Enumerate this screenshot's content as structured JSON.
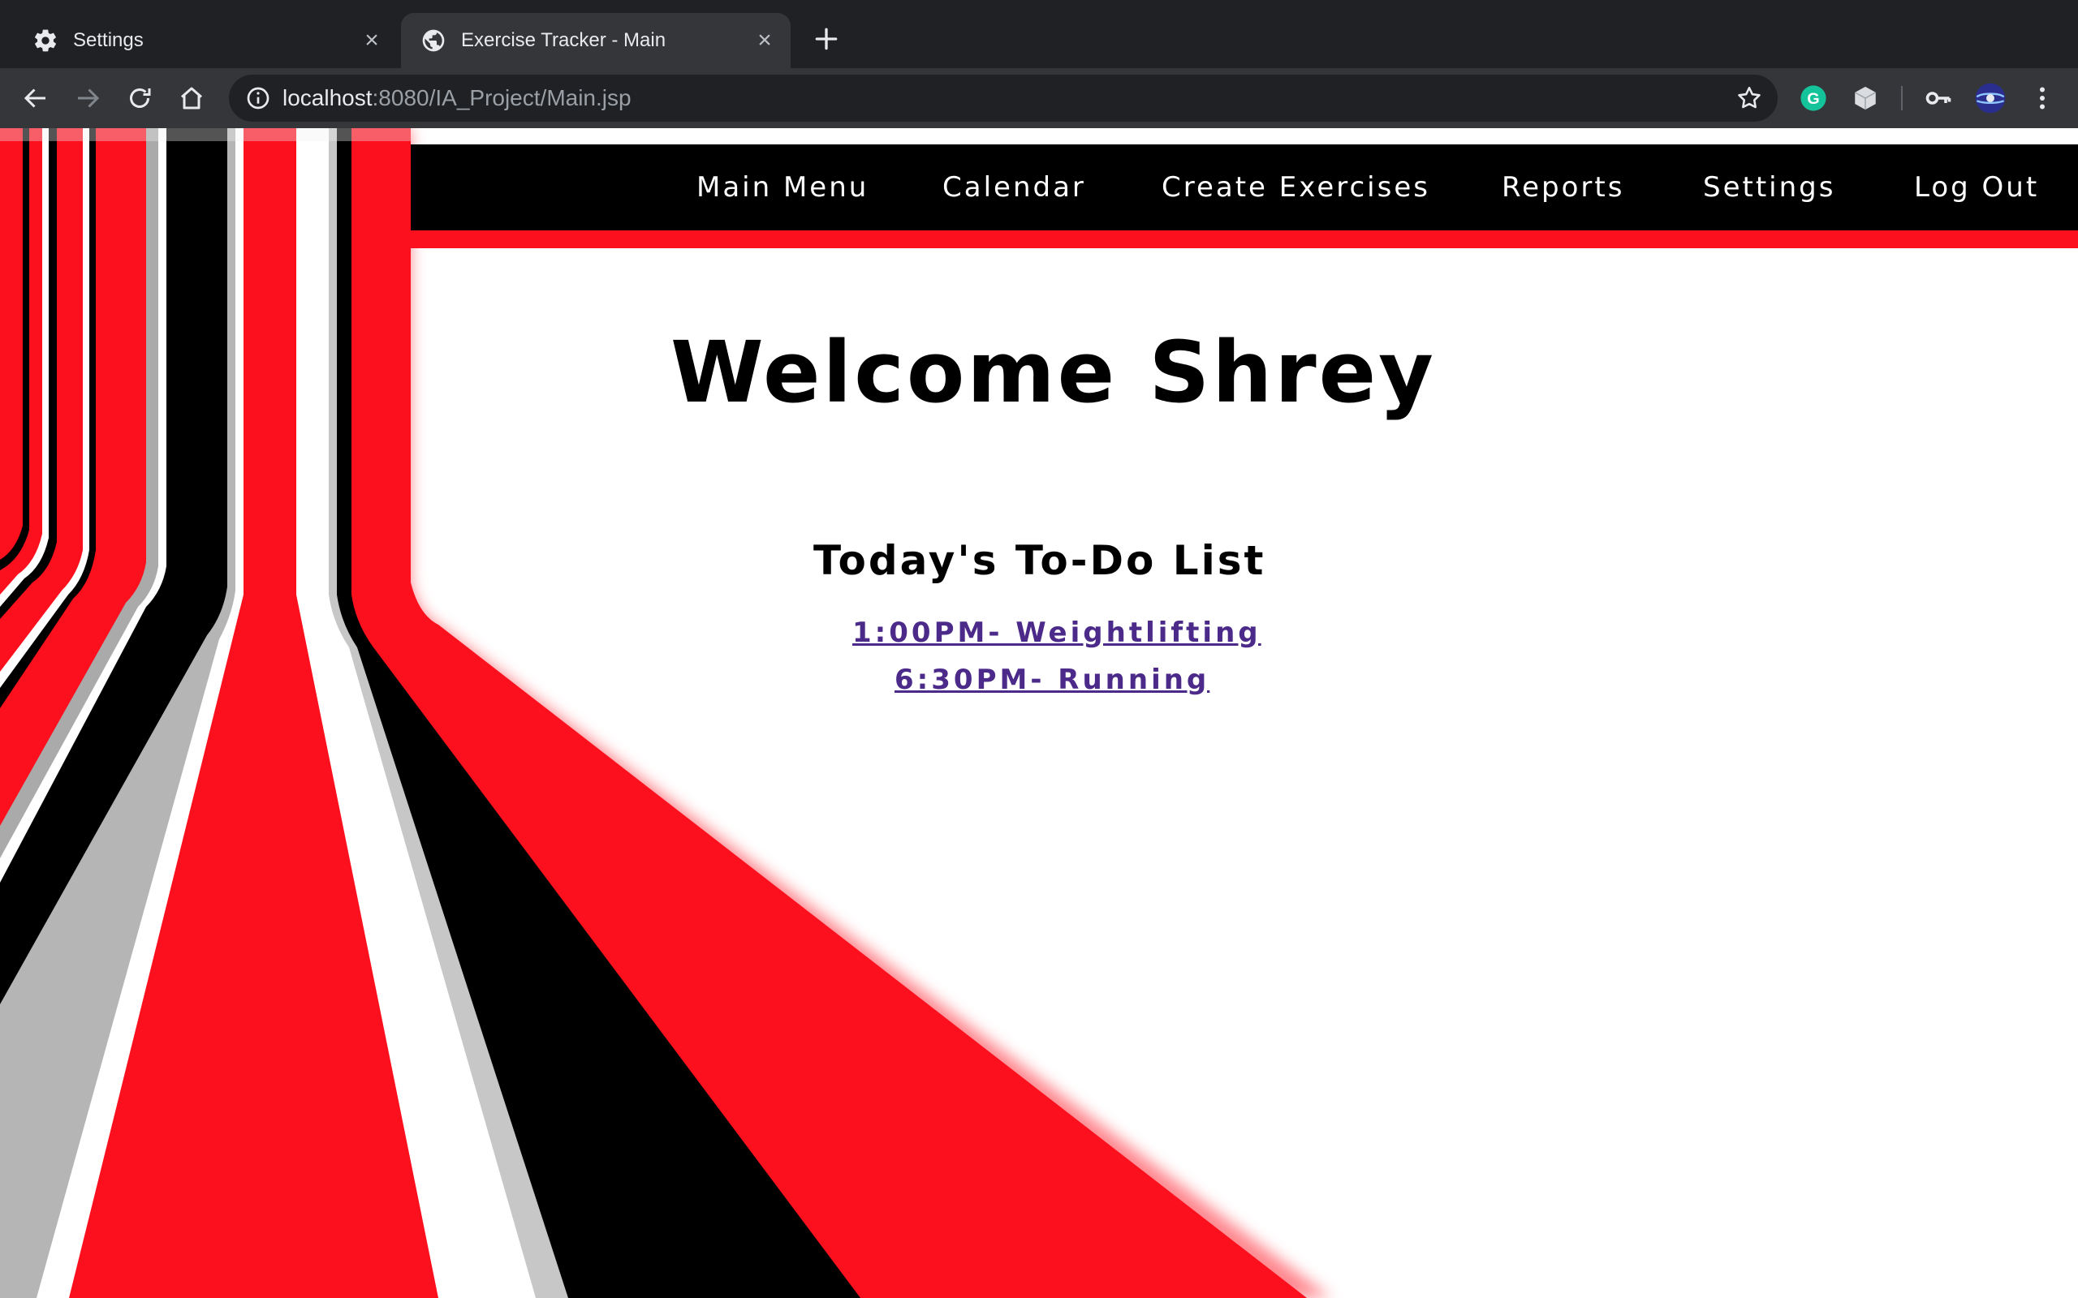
{
  "browser": {
    "tabs": [
      {
        "title": "Settings",
        "icon": "gear-icon",
        "active": false
      },
      {
        "title": "Exercise Tracker - Main",
        "icon": "globe-icon",
        "active": true
      }
    ],
    "url_host": "localhost",
    "url_path": ":8080/IA_Project/Main.jsp",
    "extensions": [
      "grammarly-icon",
      "cube-extension-icon",
      "key-icon",
      "profile-avatar"
    ]
  },
  "nav": {
    "items": [
      "Main Menu",
      "Calendar",
      "Create Exercises",
      "Reports",
      "Settings",
      "Log Out"
    ]
  },
  "main": {
    "welcome": "Welcome Shrey",
    "todo_heading": "Today's To-Do List",
    "todo_items": [
      "1:00PM- Weightlifting",
      "6:30PM- Running"
    ]
  },
  "colors": {
    "accent_red": "#fc101e",
    "nav_bg": "#000000",
    "link_visited": "#4b2a8a",
    "chrome_dark": "#202124",
    "chrome_toolbar": "#35363a"
  }
}
